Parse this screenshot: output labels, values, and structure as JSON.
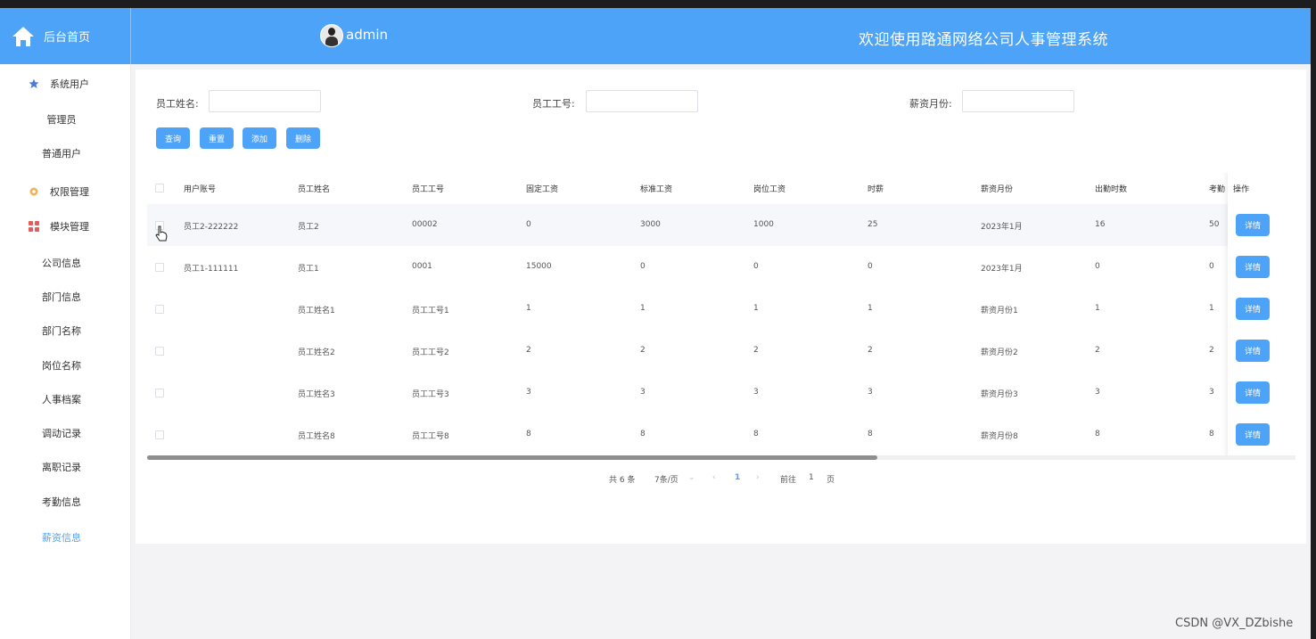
{
  "colors": {
    "primary": "#4da3f7",
    "header_bg": "#4da3f7",
    "active_menu": "#4da3f7"
  },
  "header": {
    "home_title": "后台首页",
    "username": "admin",
    "welcome": "欢迎使用路通网络公司人事管理系统"
  },
  "sidebar": {
    "group_system_users": "系统用户",
    "admin": "管理员",
    "normal_user": "普通用户",
    "group_permissions": "权限管理",
    "group_modules": "模块管理",
    "items": [
      "公司信息",
      "部门信息",
      "部门名称",
      "岗位名称",
      "人事档案",
      "调动记录",
      "离职记录",
      "考勤信息",
      "薪资信息"
    ]
  },
  "search": {
    "name_label": "员工姓名:",
    "name_value": "",
    "id_label": "员工工号:",
    "id_value": "",
    "month_label": "薪资月份:",
    "month_value": ""
  },
  "buttons": {
    "query": "查询",
    "reset": "重置",
    "add": "添加",
    "delete": "删除"
  },
  "table": {
    "columns": [
      "用户账号",
      "员工姓名",
      "员工工号",
      "固定工资",
      "标准工资",
      "岗位工资",
      "时薪",
      "薪资月份",
      "出勤时数",
      "考勤"
    ],
    "action_header": "操作",
    "detail_label": "详情",
    "rows": [
      [
        "员工2-222222",
        "员工2",
        "00002",
        "0",
        "3000",
        "1000",
        "25",
        "2023年1月",
        "16",
        "50"
      ],
      [
        "员工1-111111",
        "员工1",
        "0001",
        "15000",
        "0",
        "0",
        "0",
        "2023年1月",
        "0",
        "0"
      ],
      [
        "",
        "员工姓名1",
        "员工工号1",
        "1",
        "1",
        "1",
        "1",
        "薪资月份1",
        "1",
        "1"
      ],
      [
        "",
        "员工姓名2",
        "员工工号2",
        "2",
        "2",
        "2",
        "2",
        "薪资月份2",
        "2",
        "2"
      ],
      [
        "",
        "员工姓名3",
        "员工工号3",
        "3",
        "3",
        "3",
        "3",
        "薪资月份3",
        "3",
        "3"
      ],
      [
        "",
        "员工姓名8",
        "员工工号8",
        "8",
        "8",
        "8",
        "8",
        "薪资月份8",
        "8",
        "8"
      ]
    ]
  },
  "pagination": {
    "total": "共 6 条",
    "page_size": "7条/页",
    "current_page": "1",
    "goto_label": "前往",
    "goto_value": "1",
    "page_unit": "页"
  },
  "watermark": "CSDN @VX_DZbishe"
}
